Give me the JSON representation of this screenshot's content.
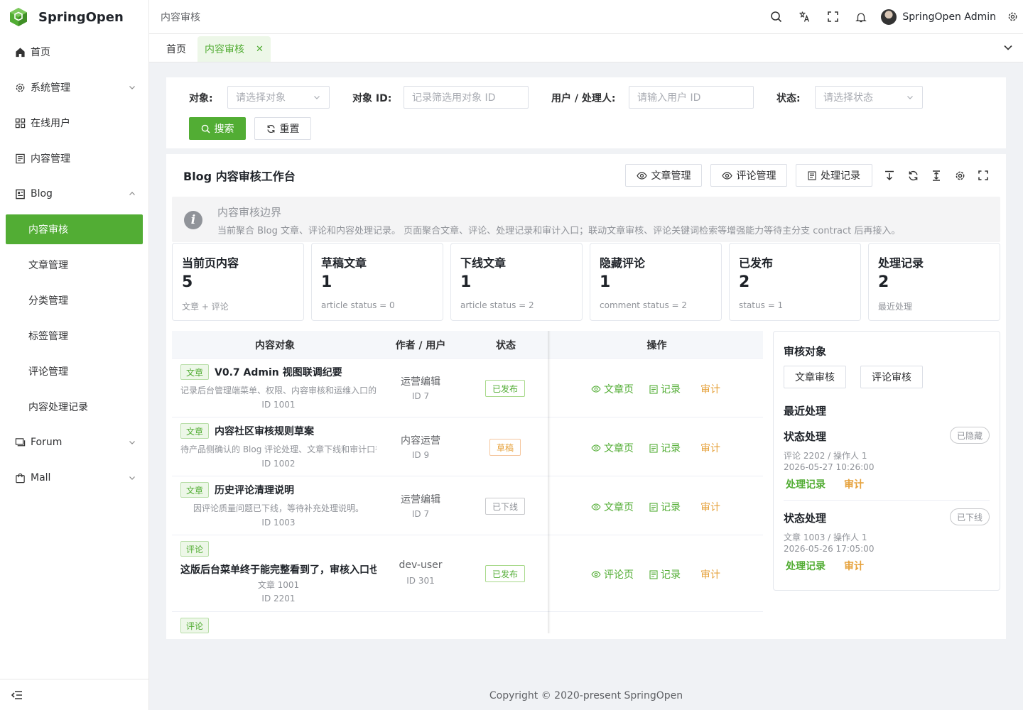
{
  "app": {
    "name": "SpringOpen"
  },
  "sidebar": {
    "items": [
      {
        "label": "首页",
        "icon": "home-icon"
      },
      {
        "label": "系统管理",
        "icon": "gear-icon"
      },
      {
        "label": "在线用户",
        "icon": "grid-icon"
      },
      {
        "label": "内容管理",
        "icon": "document-icon"
      },
      {
        "label": "Blog",
        "icon": "blog-icon"
      }
    ],
    "blog_children": [
      "内容审核",
      "文章管理",
      "分类管理",
      "标签管理",
      "评论管理",
      "内容处理记录"
    ],
    "after_items": [
      {
        "label": "Forum",
        "icon": "forum-icon"
      },
      {
        "label": "Mall",
        "icon": "bag-icon"
      }
    ]
  },
  "header": {
    "breadcrumb": "内容审核",
    "user_name": "SpringOpen Admin"
  },
  "tabs": [
    {
      "label": "首页"
    },
    {
      "label": "内容审核"
    }
  ],
  "filters": {
    "object_label": "对象:",
    "object_placeholder": "请选择对象",
    "object_id_label": "对象 ID:",
    "object_id_placeholder": "记录筛选用对象 ID",
    "user_label": "用户 / 处理人:",
    "user_placeholder": "请输入用户 ID",
    "status_label": "状态:",
    "status_placeholder": "请选择状态",
    "search_label": "搜索",
    "reset_label": "重置"
  },
  "workbench": {
    "title": "Blog 内容审核工作台",
    "btn_articles": "文章管理",
    "btn_comments": "评论管理",
    "btn_records": "处理记录"
  },
  "alert": {
    "title": "内容审核边界",
    "desc": "当前聚合 Blog 文章、评论和内容处理记录。 页面聚合文章、评论、处理记录和审计入口；联动文章审核、评论关键词检索等增强能力等待主分支 contract 后再接入。"
  },
  "stats": [
    {
      "label": "当前页内容",
      "value": "5",
      "desc": "文章 + 评论"
    },
    {
      "label": "草稿文章",
      "value": "1",
      "desc": "article status = 0"
    },
    {
      "label": "下线文章",
      "value": "1",
      "desc": "article status = 2"
    },
    {
      "label": "隐藏评论",
      "value": "1",
      "desc": "comment status = 2"
    },
    {
      "label": "已发布",
      "value": "2",
      "desc": "status = 1"
    },
    {
      "label": "处理记录",
      "value": "2",
      "desc": "最近处理"
    }
  ],
  "table": {
    "headers": {
      "object": "内容对象",
      "author": "作者 / 用户",
      "status": "状态",
      "ops": "操作"
    },
    "rows": [
      {
        "type": "文章",
        "title": "V0.7 Admin 视图联调纪要",
        "desc": "记录后台管理端菜单、权限、内容审核和运维入口的",
        "id": "ID 1001",
        "author": "运营编辑",
        "author_id": "ID 7",
        "status": "已发布",
        "view": "文章页",
        "record": "记录",
        "audit": "审计"
      },
      {
        "type": "文章",
        "title": "内容社区审核规则草案",
        "desc": "待产品侧确认的 Blog 评论处理、文章下线和审计口径",
        "id": "ID 1002",
        "author": "内容运营",
        "author_id": "ID 9",
        "status": "草稿",
        "view": "文章页",
        "record": "记录",
        "audit": "审计"
      },
      {
        "type": "文章",
        "title": "历史评论清理说明",
        "desc": "因评论质量问题已下线，等待补充处理说明。",
        "id": "ID 1003",
        "author": "运营编辑",
        "author_id": "ID 7",
        "status": "已下线",
        "view": "文章页",
        "record": "记录",
        "audit": "审计"
      },
      {
        "type": "评论",
        "title": "这版后台菜单终于能完整看到了，审核入口也",
        "desc": "文章 1001",
        "id": "ID 2201",
        "author": "dev-user",
        "author_id": "ID 301",
        "status": "已发布",
        "view": "评论页",
        "record": "记录",
        "audit": "审计"
      },
      {
        "type": "评论"
      }
    ]
  },
  "panel": {
    "title": "审核对象",
    "btn_article_review": "文章审核",
    "btn_comment_review": "评论审核",
    "recent_title": "最近处理",
    "records": [
      {
        "title": "状态处理",
        "badge": "已隐藏",
        "meta": "评论 2202 / 操作人 1",
        "time": "2026-05-27 10:26:00",
        "link_records": "处理记录",
        "link_audit": "审计"
      },
      {
        "title": "状态处理",
        "badge": "已下线",
        "meta": "文章 1003 / 操作人 1",
        "time": "2026-05-26 17:05:00",
        "link_records": "处理记录",
        "link_audit": "审计"
      }
    ]
  },
  "footer": {
    "copyright": "Copyright © 2020-present SpringOpen"
  },
  "colors": {
    "primary": "#52ad34",
    "warning": "#e6a23c",
    "muted": "#909399"
  }
}
